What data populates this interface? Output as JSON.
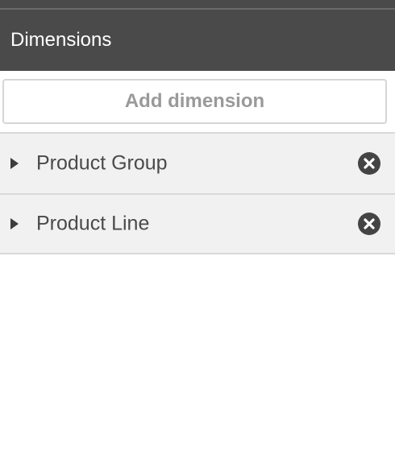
{
  "header": {
    "title": "Dimensions"
  },
  "actions": {
    "add_label": "Add dimension"
  },
  "dimensions": [
    {
      "label": "Product Group",
      "icon": "expand-triangle-icon",
      "remove_icon": "remove-circle-x-icon"
    },
    {
      "label": "Product Line",
      "icon": "expand-triangle-icon",
      "remove_icon": "remove-circle-x-icon"
    }
  ],
  "colors": {
    "header_bg": "#4a4a4a",
    "item_bg": "#f1f1f1",
    "text": "#4a4a4a",
    "button_text": "#9a9a9a"
  }
}
